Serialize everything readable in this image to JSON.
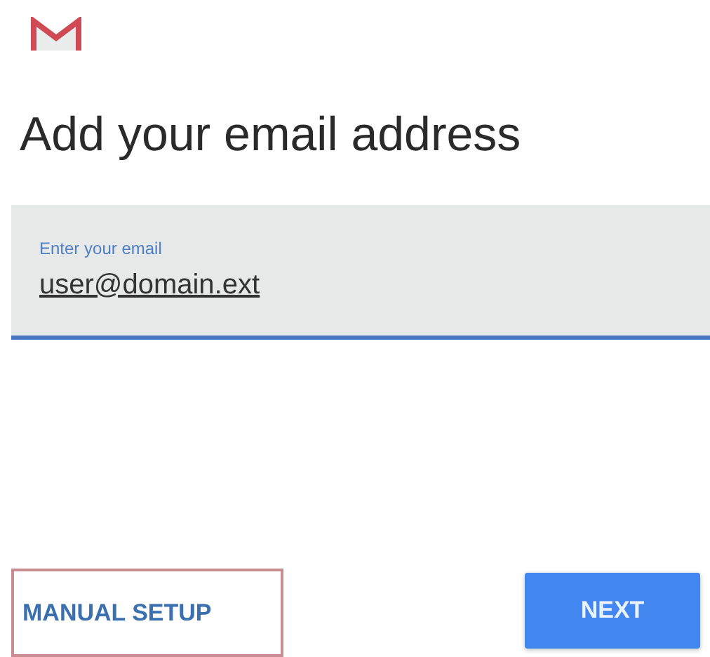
{
  "title": "Add your email address",
  "email_field": {
    "label": "Enter your email",
    "value": "user@domain.ext",
    "focused": true
  },
  "buttons": [
    {
      "kind": "text",
      "label": "MANUAL SETUP",
      "highlighted": true
    },
    {
      "kind": "filled",
      "label": "NEXT",
      "highlighted": false
    }
  ]
}
